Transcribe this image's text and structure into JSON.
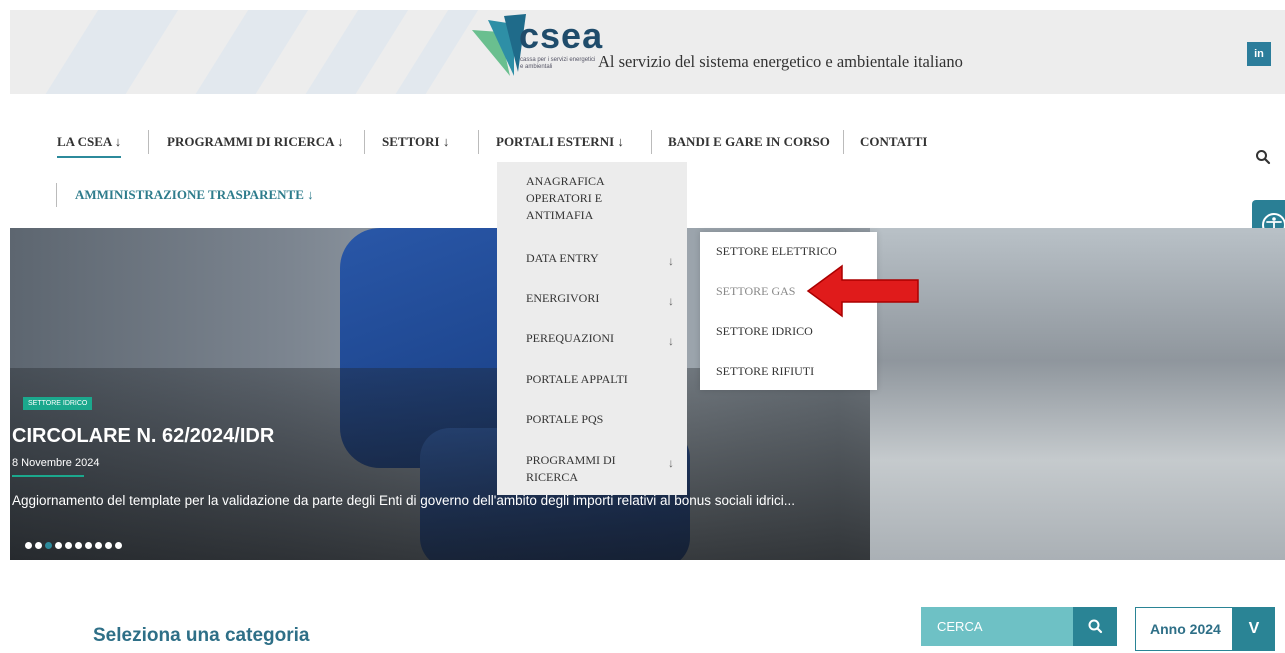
{
  "header": {
    "logo_word": "csea",
    "logo_sub": "cassa per i servizi energetici e ambientali",
    "tagline": "Al servizio del sistema energetico e ambientale italiano",
    "linkedin_label": "in"
  },
  "nav": {
    "items": [
      {
        "label": "LA CSEA ↓"
      },
      {
        "label": "PROGRAMMI DI RICERCA ↓"
      },
      {
        "label": "SETTORI ↓"
      },
      {
        "label": "PORTALI ESTERNI ↓"
      },
      {
        "label": "BANDI E GARE IN CORSO"
      },
      {
        "label": "CONTATTI"
      },
      {
        "label": "AMMINISTRAZIONE TRASPARENTE ↓"
      }
    ]
  },
  "dropdown_portali": {
    "items": [
      {
        "label": "ANAGRAFICA OPERATORI E ANTIMAFIA",
        "arrow": ""
      },
      {
        "label": "DATA ENTRY",
        "arrow": "↓"
      },
      {
        "label": "ENERGIVORI",
        "arrow": "↓"
      },
      {
        "label": "PEREQUAZIONI",
        "arrow": "↓"
      },
      {
        "label": "PORTALE APPALTI",
        "arrow": ""
      },
      {
        "label": "PORTALE PQS",
        "arrow": ""
      },
      {
        "label": "PROGRAMMI DI RICERCA",
        "arrow": "↓"
      }
    ]
  },
  "dropdown_data_entry": {
    "items": [
      {
        "label": "SETTORE ELETTRICO"
      },
      {
        "label": "SETTORE GAS"
      },
      {
        "label": "SETTORE IDRICO"
      },
      {
        "label": "SETTORE RIFIUTI"
      }
    ]
  },
  "hero": {
    "badge": "SETTORE IDRICO",
    "title": "CIRCOLARE N. 62/2024/IDR",
    "date": "8 Novembre 2024",
    "description": "Aggiornamento del template per la validazione da parte degli Enti di governo dell'ambito degli importi relativi al bonus sociali idrici...",
    "slide_count": 10,
    "active_slide": 3
  },
  "bottom": {
    "category_title": "Seleziona una categoria",
    "search_label": "CERCA",
    "year_label": "Anno 2024",
    "year_button": "V"
  },
  "colors": {
    "teal": "#2a8495",
    "accent_green": "#1ba88d",
    "navy": "#1f4c6b"
  }
}
